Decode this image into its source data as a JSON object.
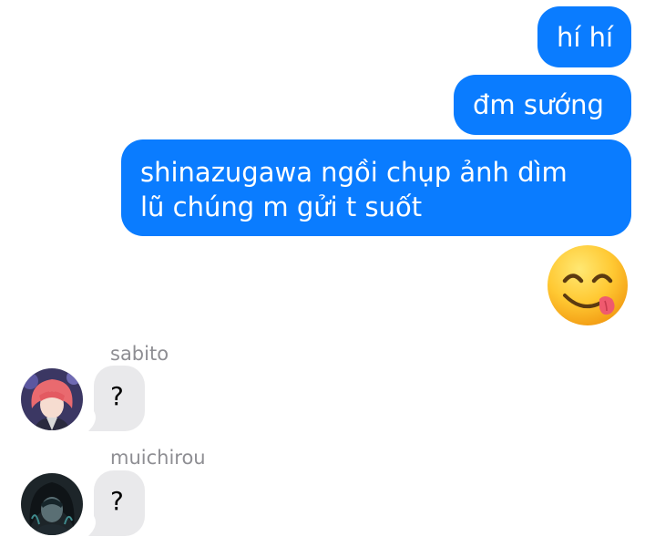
{
  "colors": {
    "outgoing_bubble": "#0a7cff",
    "incoming_bubble": "#e9e9eb",
    "sender_name": "#8e8e93"
  },
  "messages": {
    "outgoing": [
      {
        "text": "hí hí"
      },
      {
        "text": "đm sướng"
      },
      {
        "lines": [
          "shinazugawa ngồi chụp ảnh dìm",
          "lũ chúng m gửi t suốt"
        ]
      }
    ],
    "emoji": {
      "icon": "face-savoring-food-emoji"
    },
    "incoming": [
      {
        "sender": "sabito",
        "text": "?",
        "avatar": "sabito-avatar"
      },
      {
        "sender": "muichirou",
        "text": "?",
        "avatar": "muichirou-avatar"
      }
    ]
  }
}
